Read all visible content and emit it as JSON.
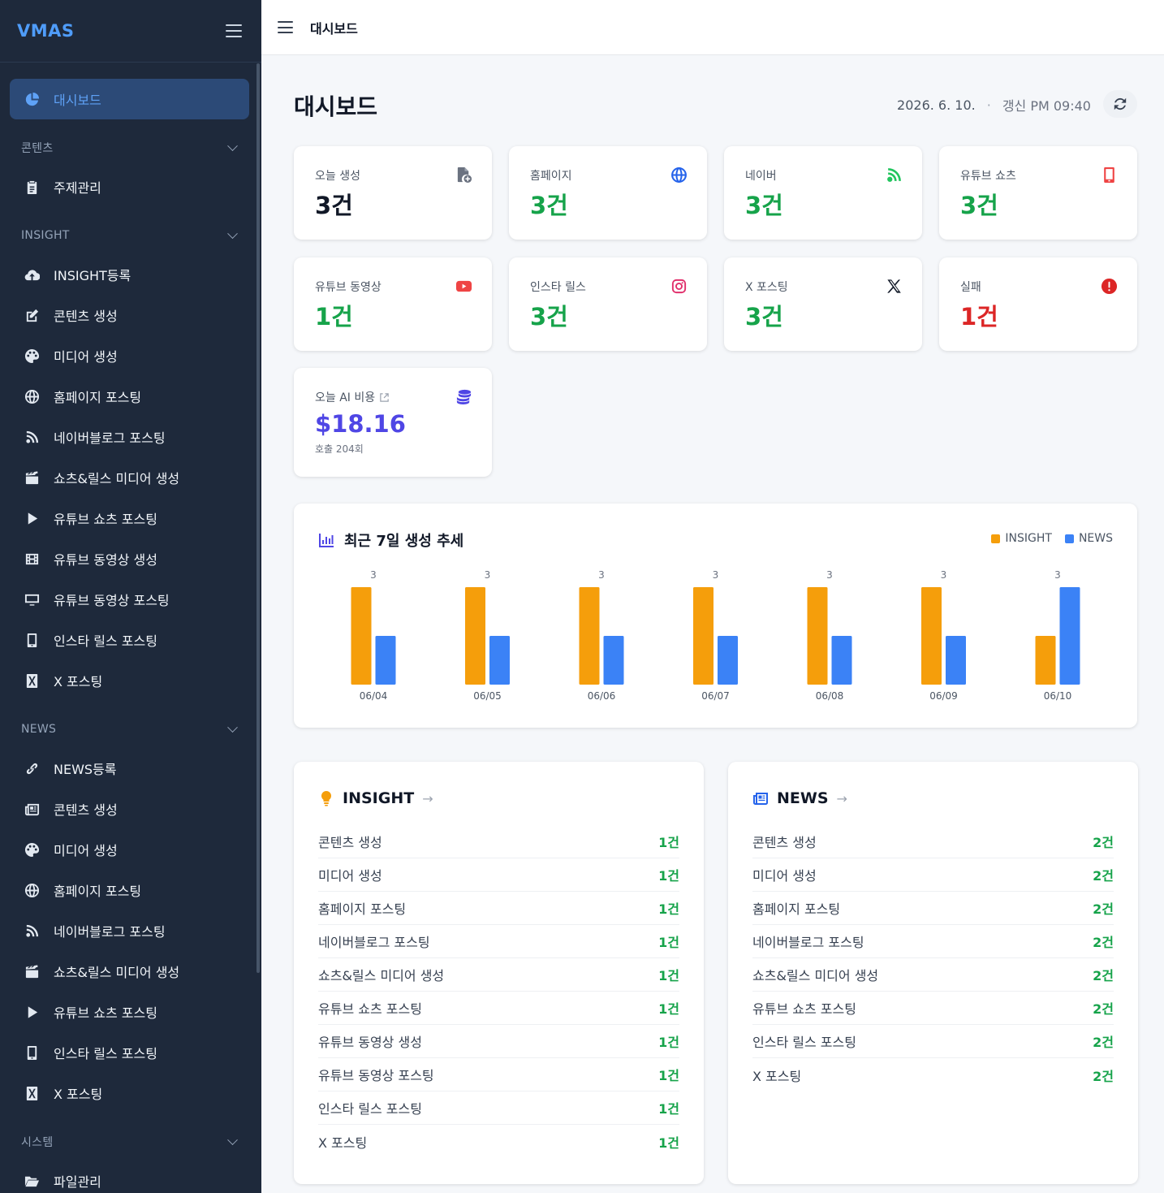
{
  "app": {
    "logo": "VMAS"
  },
  "topbar": {
    "title": "대시보드"
  },
  "sidebar": {
    "active": {
      "label": "대시보드",
      "icon": "pie-chart-icon"
    },
    "sections": [
      {
        "title": "콘텐츠",
        "items": [
          {
            "label": "주제관리",
            "icon": "clipboard-icon"
          }
        ]
      },
      {
        "title": "INSIGHT",
        "items": [
          {
            "label": "INSIGHT등록",
            "icon": "cloud-upload-icon"
          },
          {
            "label": "콘텐츠 생성",
            "icon": "edit-icon"
          },
          {
            "label": "미디어 생성",
            "icon": "palette-icon"
          },
          {
            "label": "홈페이지 포스팅",
            "icon": "globe-icon"
          },
          {
            "label": "네이버블로그 포스팅",
            "icon": "blog-icon"
          },
          {
            "label": "쇼츠&릴스 미디어 생성",
            "icon": "clapperboard-icon"
          },
          {
            "label": "유튜브 쇼츠 포스팅",
            "icon": "play-icon"
          },
          {
            "label": "유튜브 동영상 생성",
            "icon": "film-icon"
          },
          {
            "label": "유튜브 동영상 포스팅",
            "icon": "monitor-icon"
          },
          {
            "label": "인스타 릴스 포스팅",
            "icon": "mobile-icon"
          },
          {
            "label": "X 포스팅",
            "icon": "x-square-icon"
          }
        ]
      },
      {
        "title": "NEWS",
        "items": [
          {
            "label": "NEWS등록",
            "icon": "link-icon"
          },
          {
            "label": "콘텐츠 생성",
            "icon": "newspaper-icon"
          },
          {
            "label": "미디어 생성",
            "icon": "palette-icon"
          },
          {
            "label": "홈페이지 포스팅",
            "icon": "globe-icon"
          },
          {
            "label": "네이버블로그 포스팅",
            "icon": "blog-icon"
          },
          {
            "label": "쇼츠&릴스 미디어 생성",
            "icon": "clapperboard-icon"
          },
          {
            "label": "유튜브 쇼츠 포스팅",
            "icon": "play-icon"
          },
          {
            "label": "인스타 릴스 포스팅",
            "icon": "mobile-icon"
          },
          {
            "label": "X 포스팅",
            "icon": "x-square-icon"
          }
        ]
      },
      {
        "title": "시스템",
        "items": [
          {
            "label": "파일관리",
            "icon": "folder-open-icon"
          }
        ]
      }
    ]
  },
  "header": {
    "title": "대시보드",
    "date": "2026. 6. 10.",
    "separator": "·",
    "updated": "갱신 PM 09:40"
  },
  "stats": [
    {
      "label": "오늘 생성",
      "value": "3건",
      "icon": "file-plus-icon",
      "tone": "dark"
    },
    {
      "label": "홈페이지",
      "value": "3건",
      "icon": "globe-icon",
      "tone": "green"
    },
    {
      "label": "네이버",
      "value": "3건",
      "icon": "blog-icon",
      "tone": "green"
    },
    {
      "label": "유튜브 쇼츠",
      "value": "3건",
      "icon": "mobile-icon",
      "tone": "green"
    },
    {
      "label": "유튜브 동영상",
      "value": "1건",
      "icon": "youtube-icon",
      "tone": "green"
    },
    {
      "label": "인스타 릴스",
      "value": "3건",
      "icon": "instagram-icon",
      "tone": "green"
    },
    {
      "label": "X 포스팅",
      "value": "3건",
      "icon": "x-logo-icon",
      "tone": "green"
    },
    {
      "label": "실패",
      "value": "1건",
      "icon": "alert-circle-icon",
      "tone": "red"
    }
  ],
  "ai_cost": {
    "label": "오늘 AI 비용",
    "value": "$18.16",
    "sub": "호출 204회",
    "icon": "coins-icon"
  },
  "chart_data": {
    "type": "bar",
    "title": "최근 7일 생성 추세",
    "categories": [
      "06/04",
      "06/05",
      "06/06",
      "06/07",
      "06/08",
      "06/09",
      "06/10"
    ],
    "series": [
      {
        "name": "INSIGHT",
        "color": "#f59e0b",
        "values": [
          2,
          2,
          2,
          2,
          2,
          2,
          1
        ]
      },
      {
        "name": "NEWS",
        "color": "#3b82f6",
        "values": [
          1,
          1,
          1,
          1,
          1,
          1,
          2
        ]
      }
    ],
    "totals": [
      3,
      3,
      3,
      3,
      3,
      3,
      3
    ],
    "ylim": [
      0,
      2
    ],
    "legend": "top-right",
    "grid": false
  },
  "insight_list": {
    "title": "INSIGHT",
    "arrow": "→",
    "rows": [
      {
        "label": "콘텐츠 생성",
        "count": "1건"
      },
      {
        "label": "미디어 생성",
        "count": "1건"
      },
      {
        "label": "홈페이지 포스팅",
        "count": "1건"
      },
      {
        "label": "네이버블로그 포스팅",
        "count": "1건"
      },
      {
        "label": "쇼츠&릴스 미디어 생성",
        "count": "1건"
      },
      {
        "label": "유튜브 쇼츠 포스팅",
        "count": "1건"
      },
      {
        "label": "유튜브 동영상 생성",
        "count": "1건"
      },
      {
        "label": "유튜브 동영상 포스팅",
        "count": "1건"
      },
      {
        "label": "인스타 릴스 포스팅",
        "count": "1건"
      },
      {
        "label": "X 포스팅",
        "count": "1건"
      }
    ]
  },
  "news_list": {
    "title": "NEWS",
    "arrow": "→",
    "rows": [
      {
        "label": "콘텐츠 생성",
        "count": "2건"
      },
      {
        "label": "미디어 생성",
        "count": "2건"
      },
      {
        "label": "홈페이지 포스팅",
        "count": "2건"
      },
      {
        "label": "네이버블로그 포스팅",
        "count": "2건"
      },
      {
        "label": "쇼츠&릴스 미디어 생성",
        "count": "2건"
      },
      {
        "label": "유튜브 쇼츠 포스팅",
        "count": "2건"
      },
      {
        "label": "인스타 릴스 포스팅",
        "count": "2건"
      },
      {
        "label": "X 포스팅",
        "count": "2건"
      }
    ]
  }
}
